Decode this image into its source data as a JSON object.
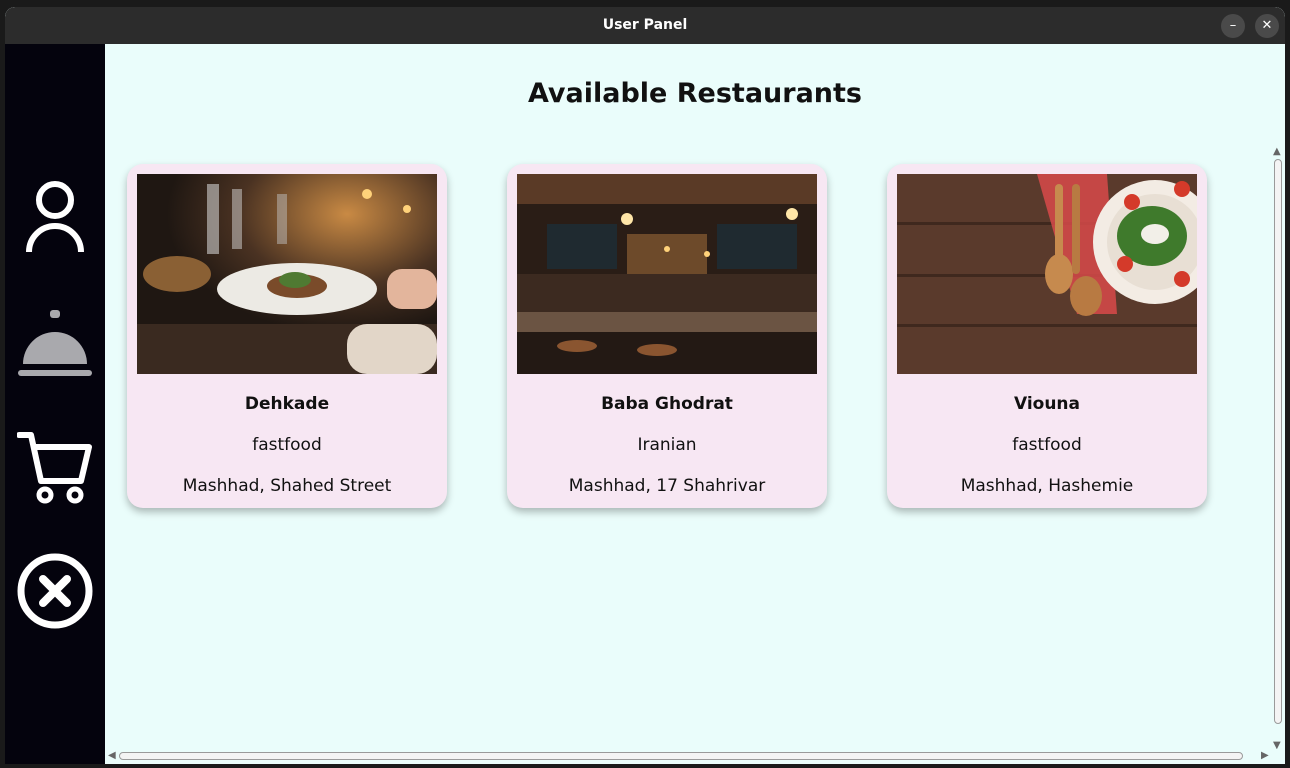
{
  "window": {
    "title": "User Panel",
    "minimize_icon": "minimize-icon",
    "close_icon": "close-icon"
  },
  "sidebar": {
    "items": [
      {
        "name": "profile",
        "icon": "user-icon"
      },
      {
        "name": "restaurants",
        "icon": "cloche-icon"
      },
      {
        "name": "cart",
        "icon": "cart-icon"
      },
      {
        "name": "exit",
        "icon": "close-circle-icon"
      }
    ]
  },
  "main": {
    "heading": "Available Restaurants",
    "restaurants": [
      {
        "name": "Dehkade",
        "category": "fastfood",
        "address": "Mashhad, Shahed Street"
      },
      {
        "name": "Baba Ghodrat",
        "category": "Iranian",
        "address": "Mashhad, 17 Shahrivar"
      },
      {
        "name": "Viouna",
        "category": "fastfood",
        "address": "Mashhad, Hashemie"
      }
    ]
  },
  "colors": {
    "sidebar_bg": "#04030d",
    "content_bg": "#eafdfb",
    "card_bg": "#f7e7f3",
    "titlebar_bg": "#2c2c2c"
  }
}
